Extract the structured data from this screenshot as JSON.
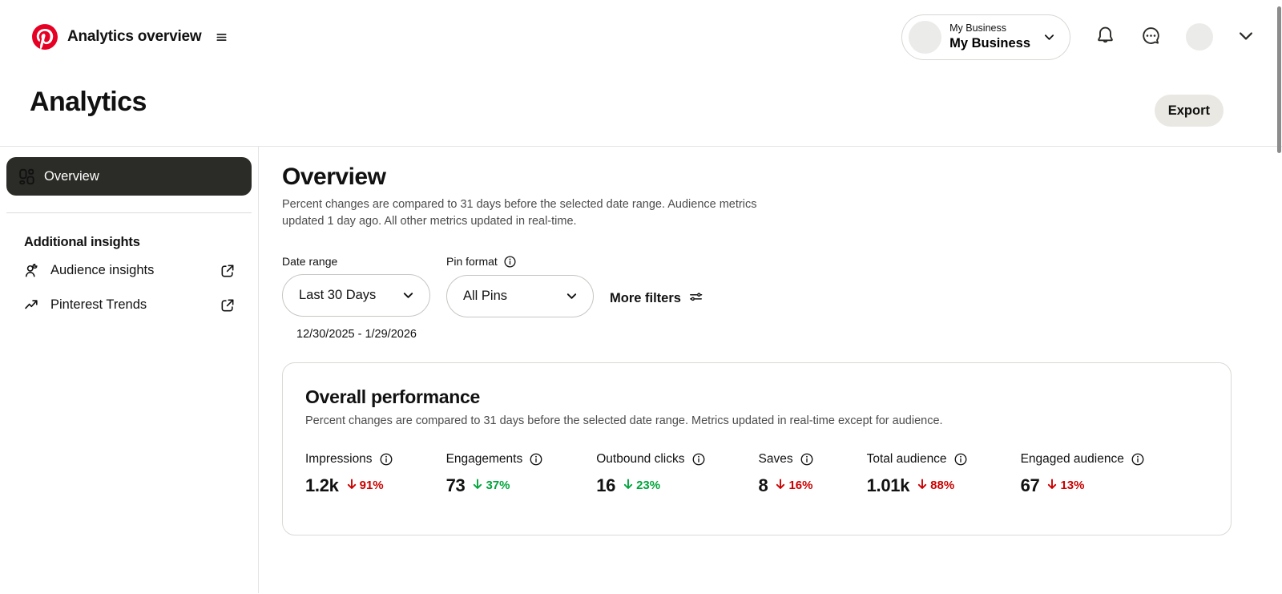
{
  "header": {
    "app_title": "Analytics overview",
    "account": {
      "label": "My Business",
      "name": "My Business"
    }
  },
  "page": {
    "title": "Analytics",
    "export_label": "Export"
  },
  "sidebar": {
    "items": [
      {
        "label": "Overview",
        "selected": true
      }
    ],
    "section_title": "Additional insights",
    "links": [
      {
        "label": "Audience insights"
      },
      {
        "label": "Pinterest Trends"
      }
    ]
  },
  "main": {
    "title": "Overview",
    "description": "Percent changes are compared to 31 days before the selected date range. Audience metrics updated 1 day ago. All other metrics updated in real-time.",
    "filters": {
      "date_range_label": "Date range",
      "date_range_value": "Last 30 Days",
      "date_range_note": "12/30/2025 - 1/29/2026",
      "pin_format_label": "Pin format",
      "pin_format_value": "All Pins",
      "more_filters_label": "More filters"
    },
    "card": {
      "title": "Overall performance",
      "subtitle": "Percent changes are compared to 31 days before the selected date range. Metrics updated in real-time except for audience.",
      "metrics": [
        {
          "label": "Impressions",
          "value": "1.2k",
          "direction": "down",
          "change": "91%",
          "trend": "negative"
        },
        {
          "label": "Engagements",
          "value": "73",
          "direction": "down",
          "change": "37%",
          "trend": "positive"
        },
        {
          "label": "Outbound clicks",
          "value": "16",
          "direction": "down",
          "change": "23%",
          "trend": "positive"
        },
        {
          "label": "Saves",
          "value": "8",
          "direction": "down",
          "change": "16%",
          "trend": "negative"
        },
        {
          "label": "Total audience",
          "value": "1.01k",
          "direction": "down",
          "change": "88%",
          "trend": "negative"
        },
        {
          "label": "Engaged audience",
          "value": "67",
          "direction": "down",
          "change": "13%",
          "trend": "negative"
        }
      ]
    }
  },
  "icons": [
    "pinterest-logo-icon",
    "menu-icon",
    "chevron-down-icon",
    "bell-icon",
    "chat-ellipsis-icon",
    "overview-grid-icon",
    "audience-person-icon",
    "trending-arrow-icon",
    "external-link-icon",
    "info-icon",
    "sliders-icon",
    "down-arrow-icon"
  ],
  "colors": {
    "brand_red": "#e60023",
    "negative": "#cc0000",
    "positive": "#00a53c",
    "selected_nav_bg": "#2b2b27",
    "export_bg": "#e9e8e3"
  }
}
